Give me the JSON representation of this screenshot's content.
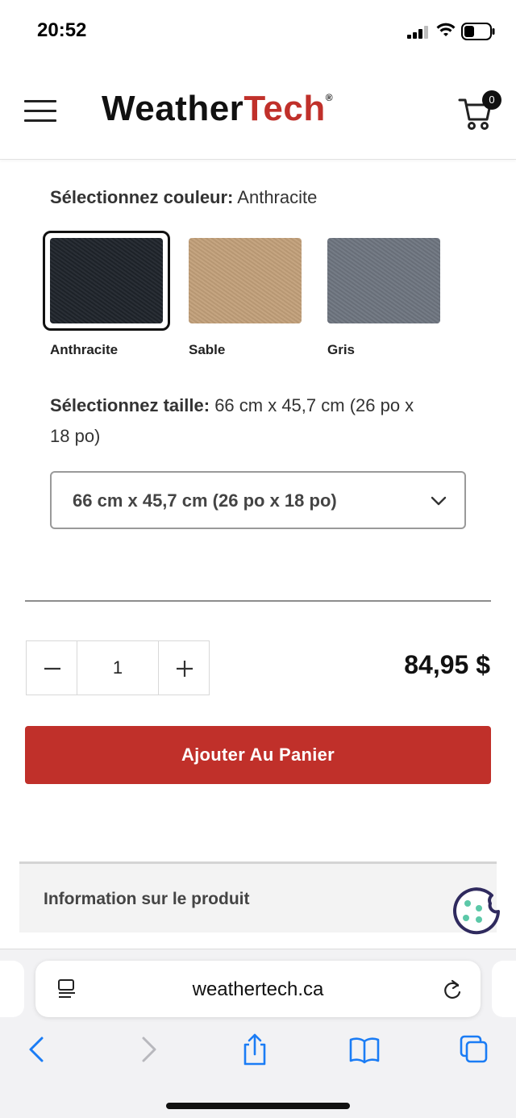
{
  "status_bar": {
    "time": "20:52"
  },
  "header": {
    "logo_weather": "Weather",
    "logo_tech": "Tech",
    "logo_reg": "®",
    "cart_count": "0"
  },
  "color_select": {
    "label": "Sélectionnez couleur:",
    "value": "Anthracite",
    "options": [
      {
        "name": "Anthracite",
        "color": "#1f242b",
        "selected": true
      },
      {
        "name": "Sable",
        "color": "#c2a07a",
        "selected": false
      },
      {
        "name": "Gris",
        "color": "#6e7580",
        "selected": false
      }
    ]
  },
  "size_select": {
    "label": "Sélectionnez taille:",
    "value": "66 cm x 45,7 cm (26 po x 18 po)",
    "dropdown_value": "66 cm x 45,7 cm (26 po x 18 po)"
  },
  "quantity": {
    "minus": "−",
    "value": "1",
    "plus": "+"
  },
  "price": "84,95 $",
  "add_to_cart_label": "Ajouter Au Panier",
  "product_info_label": "Information sur le produit",
  "safari": {
    "url": "weathertech.ca"
  },
  "colors": {
    "accent": "#c0302a",
    "cookie": "#2f2a5e",
    "ios_blue": "#1a7cf5"
  }
}
